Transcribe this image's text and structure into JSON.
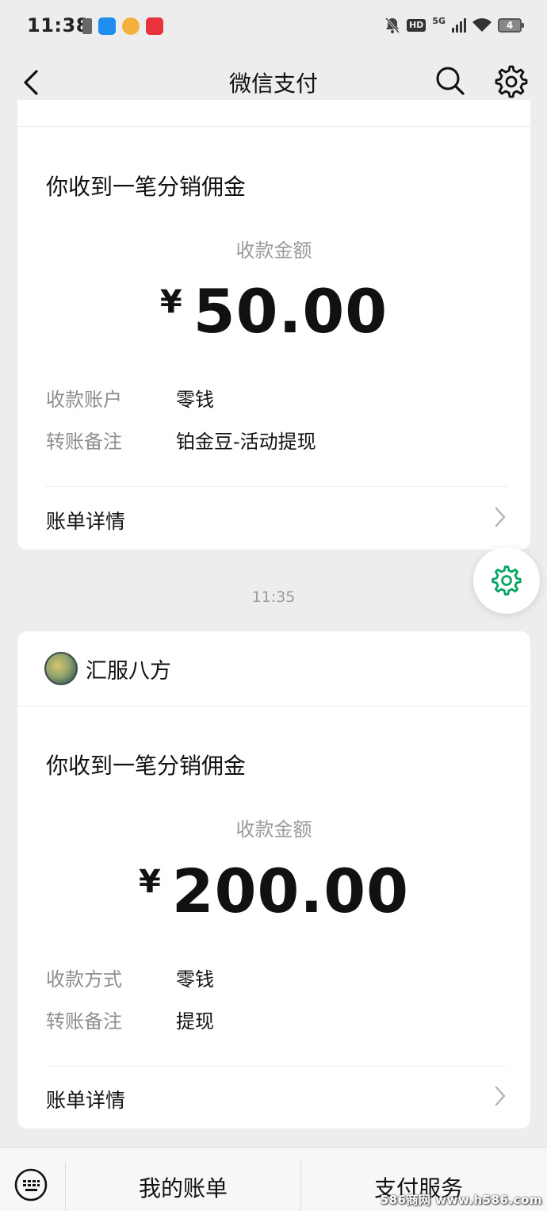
{
  "status_bar": {
    "time": "11:38",
    "network": "5G",
    "hd": "HD",
    "battery": "4"
  },
  "nav": {
    "title": "微信支付"
  },
  "messages": [
    {
      "title": "你收到一笔分销佣金",
      "amount_label": "收款金额",
      "currency": "¥",
      "amount": "50.00",
      "rows": [
        {
          "label": "收款账户",
          "value": "零钱"
        },
        {
          "label": "转账备注",
          "value": "铂金豆-活动提现"
        }
      ],
      "detail_link": "账单详情"
    },
    {
      "timestamp": "11:35",
      "sender": "汇服八方",
      "title": "你收到一笔分销佣金",
      "amount_label": "收款金额",
      "currency": "¥",
      "amount": "200.00",
      "rows": [
        {
          "label": "收款方式",
          "value": "零钱"
        },
        {
          "label": "转账备注",
          "value": "提现"
        }
      ],
      "detail_link": "账单详情"
    }
  ],
  "bottom_bar": {
    "items": [
      "我的账单",
      "支付服务"
    ]
  },
  "watermark": "586商网 www.h586.com",
  "colors": {
    "background": "#ededed",
    "card": "#ffffff",
    "accent_green": "#07c160",
    "secondary_text": "#8e8e8e"
  }
}
